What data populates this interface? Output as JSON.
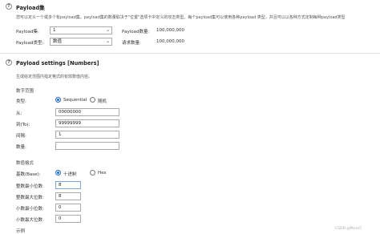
{
  "payload_sets": {
    "title": "Payload集",
    "description": "您可以定义一个或多个有payload集。payload集的数量取决于\"位置\"选项卡中定义的攻击类型。每个payload集可以使用各种payload 类型，并且可以以各种方式定制每种payload类型",
    "set_label": "Payload集:",
    "set_value": "1",
    "type_label": "Payload类型:",
    "type_value": "数值",
    "count_label": "Payload数量:",
    "count_value": "100,000,000",
    "request_label": "请求数量:",
    "request_value": "100,000,000"
  },
  "payload_settings": {
    "title": "Payload settings [Numbers]",
    "description": "生成给定范围内指定格式的有效数值内容。",
    "range_heading": "数字范围",
    "type_label": "类型:",
    "type_options": [
      "Sequential",
      "随机"
    ],
    "type_selected": "Sequential",
    "from_label": "从:",
    "from_value": "00000000",
    "to_label": "到(To):",
    "to_value": "99999999",
    "step_label": "间隔:",
    "step_value": "1",
    "count_label": "数量:",
    "count_value": "",
    "format_heading": "数值格式",
    "base_label": "基数(Base):",
    "base_options": [
      "十进制",
      "Hex"
    ],
    "base_selected": "十进制",
    "min_int_label": "整数最小位数:",
    "min_int_value": "8",
    "max_int_label": "整数最大位数:",
    "max_int_value": "8",
    "min_frac_label": "小数最小位数:",
    "min_frac_value": "0",
    "max_frac_label": "小数最大位数:",
    "max_frac_value": "0",
    "example_label": "示例"
  },
  "icons": {
    "help": "help-circle-icon",
    "dropdown": "chevron-down-icon"
  },
  "colors": {
    "accent": "#1e6bd6"
  },
  "watermark": "CSDN @MyxsC"
}
